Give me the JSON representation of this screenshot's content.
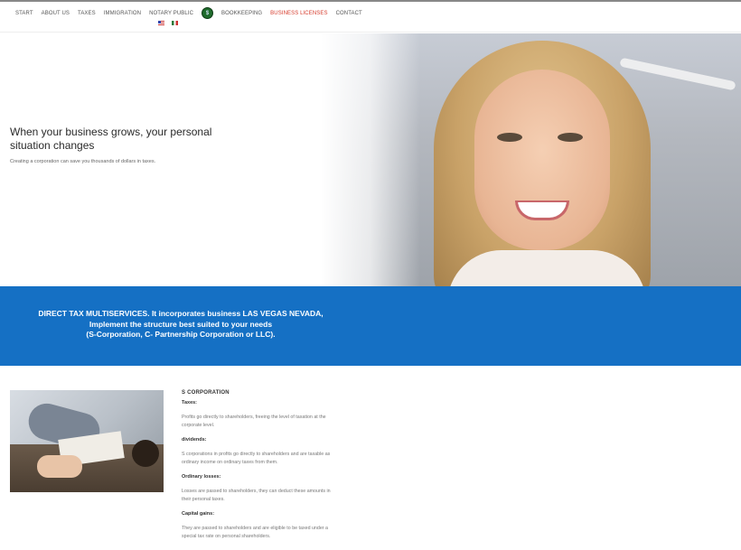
{
  "nav": {
    "items": [
      {
        "label": "START"
      },
      {
        "label": "ABOUT US"
      },
      {
        "label": "TAXES"
      },
      {
        "label": "IMMIGRATION"
      },
      {
        "label": "NOTARY PUBLIC"
      },
      {
        "label": "BOOKKEEPING"
      },
      {
        "label": "BUSINESS LICENSES",
        "active": true
      },
      {
        "label": "CONTACT"
      }
    ],
    "active_color": "#d63a2b",
    "languages": [
      "english-flag-icon",
      "spanish-flag-icon"
    ]
  },
  "hero": {
    "title": "When your business grows, your personal situation changes",
    "subtitle": "Creating a corporation can save you thousands of dollars in taxes."
  },
  "banner": {
    "line1": "DIRECT TAX MULTISERVICES. It incorporates business LAS VEGAS NEVADA,",
    "line2": "Implement the structure best suited to your needs",
    "line3": "(S-Corporation, C- Partnership Corporation or LLC).",
    "color": "#1570c4"
  },
  "content": {
    "heading": "S CORPORATION",
    "sections": [
      {
        "title": "Taxes:",
        "body": "Profits go directly to shareholders, freeing the level of taxation at the corporate level."
      },
      {
        "title": "dividends:",
        "body": "S corporations in profits go directly to shareholders and are taxable as ordinary income on ordinary taxes from them."
      },
      {
        "title": "Ordinary losses:",
        "body": "Losses are passed to shareholders, they can deduct these amounts in their personal taxes."
      },
      {
        "title": "Capital gains:",
        "body": "They are passed to shareholders and are eligible to be taxed under a special tax rate on personal shareholders."
      }
    ]
  }
}
